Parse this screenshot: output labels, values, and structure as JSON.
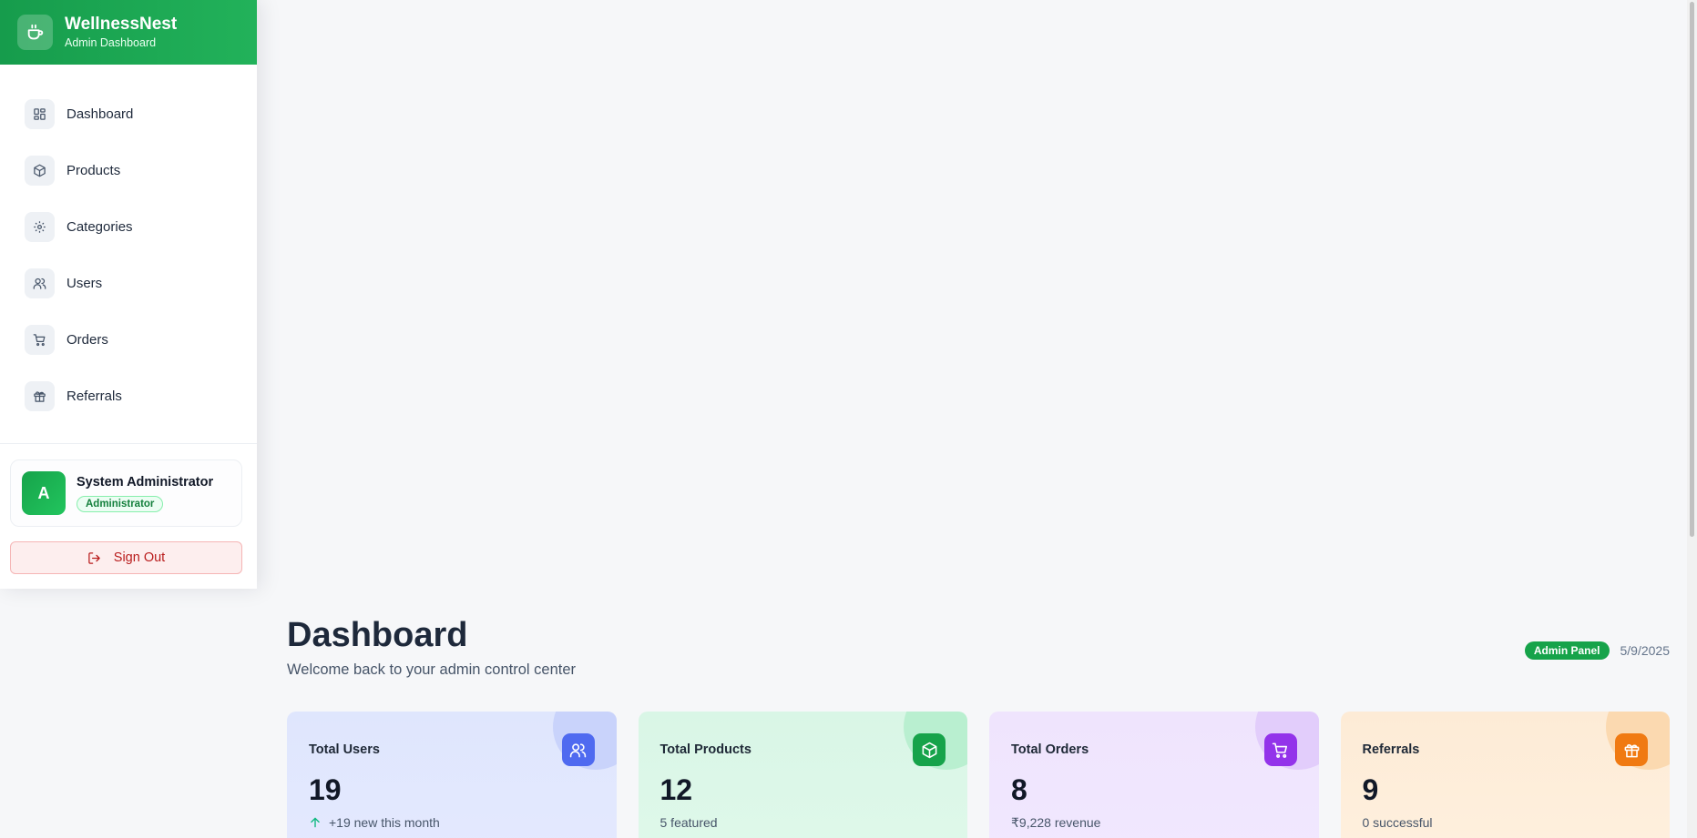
{
  "brand": {
    "name": "WellnessNest",
    "subtitle": "Admin Dashboard",
    "icon": "coffee-icon"
  },
  "sidebar": {
    "items": [
      {
        "label": "Dashboard",
        "icon": "grid-icon"
      },
      {
        "label": "Products",
        "icon": "box-icon"
      },
      {
        "label": "Categories",
        "icon": "gear-icon"
      },
      {
        "label": "Users",
        "icon": "users-icon"
      },
      {
        "label": "Orders",
        "icon": "cart-icon"
      },
      {
        "label": "Referrals",
        "icon": "gift-icon"
      }
    ],
    "user": {
      "avatar_initial": "A",
      "name": "System Administrator",
      "role": "Administrator"
    },
    "signout_label": "Sign Out"
  },
  "header": {
    "title": "Dashboard",
    "subtitle": "Welcome back to your admin control center",
    "badge": "Admin Panel",
    "date": "5/9/2025"
  },
  "cards": [
    {
      "title": "Total Users",
      "value": "19",
      "footnote": "+19 new this month",
      "icon": "users-icon",
      "accent": "#4f6af0"
    },
    {
      "title": "Total Products",
      "value": "12",
      "footnote": "5 featured",
      "icon": "box-icon",
      "accent": "#16a34a"
    },
    {
      "title": "Total Orders",
      "value": "8",
      "footnote": "₹9,228 revenue",
      "icon": "cart-icon",
      "accent": "#9333ea"
    },
    {
      "title": "Referrals",
      "value": "9",
      "footnote": "0 successful",
      "icon": "gift-icon",
      "accent": "#f07a12"
    }
  ],
  "colors": {
    "brand_green": "#16a34a",
    "danger": "#b91c1c",
    "trend_up": "#10b981"
  }
}
